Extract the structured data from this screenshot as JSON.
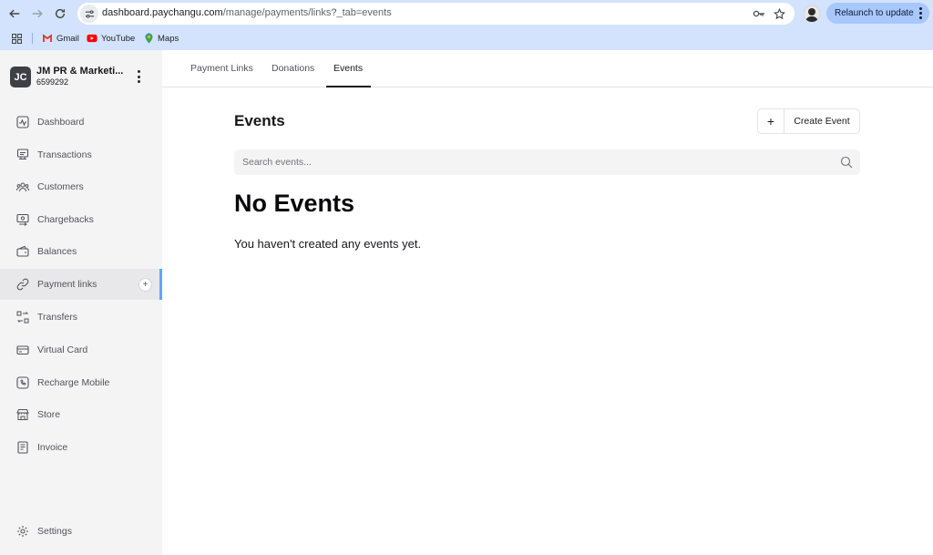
{
  "browser": {
    "url_host": "dashboard.paychangu.com",
    "url_path": "/manage/payments/links?_tab=events",
    "relaunch_label": "Relaunch to update",
    "bookmarks": [
      {
        "label": "Gmail",
        "icon": "gmail-icon"
      },
      {
        "label": "YouTube",
        "icon": "youtube-icon"
      },
      {
        "label": "Maps",
        "icon": "maps-icon"
      }
    ]
  },
  "account": {
    "initials": "JC",
    "name": "JM PR & Marketi...",
    "id": "6599292"
  },
  "sidebar": {
    "items": [
      {
        "label": "Dashboard",
        "icon": "dashboard-icon"
      },
      {
        "label": "Transactions",
        "icon": "transactions-icon"
      },
      {
        "label": "Customers",
        "icon": "customers-icon"
      },
      {
        "label": "Chargebacks",
        "icon": "chargebacks-icon"
      },
      {
        "label": "Balances",
        "icon": "balances-icon"
      },
      {
        "label": "Payment links",
        "icon": "link-icon",
        "active": true
      },
      {
        "label": "Transfers",
        "icon": "transfers-icon"
      },
      {
        "label": "Virtual Card",
        "icon": "card-icon"
      },
      {
        "label": "Recharge Mobile",
        "icon": "phone-icon"
      },
      {
        "label": "Store",
        "icon": "store-icon"
      },
      {
        "label": "Invoice",
        "icon": "invoice-icon"
      }
    ],
    "settings_label": "Settings",
    "add_symbol": "+"
  },
  "tabs": [
    {
      "label": "Payment Links"
    },
    {
      "label": "Donations"
    },
    {
      "label": "Events",
      "active": true
    }
  ],
  "main": {
    "title": "Events",
    "create_plus": "+",
    "create_label": "Create Event",
    "search_placeholder": "Search events...",
    "empty_title": "No Events",
    "empty_message": "You haven't created any events yet."
  },
  "colors": {
    "chrome_bg": "#d3e3fd",
    "sidebar_bg": "#f4f4f5",
    "active_indicator": "#60a5fa",
    "relaunch_bg": "#a8c7fa"
  }
}
